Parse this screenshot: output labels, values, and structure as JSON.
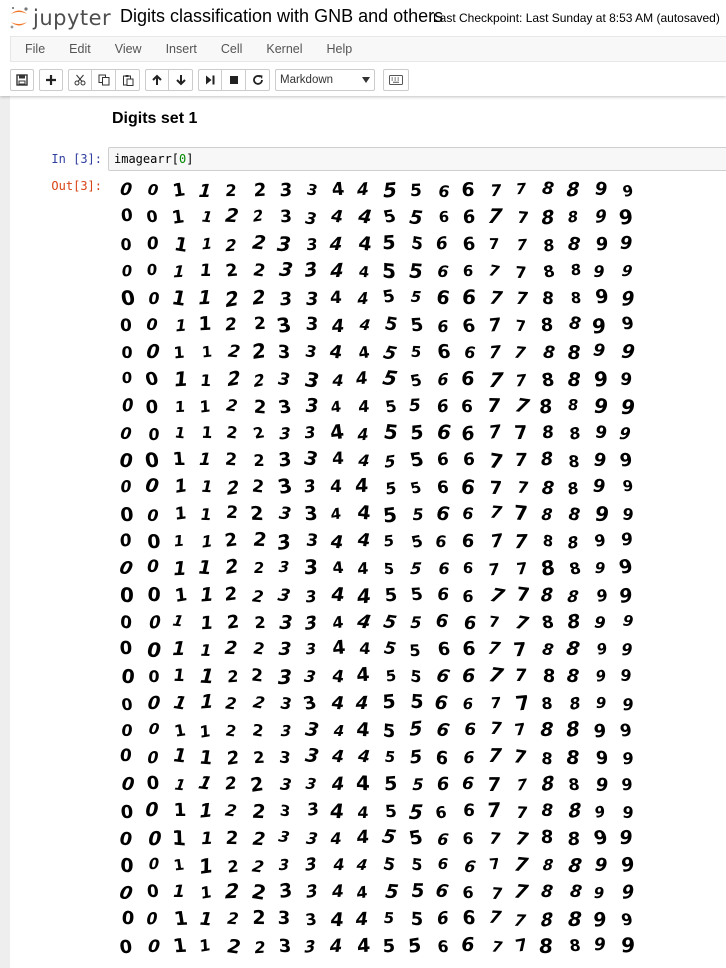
{
  "header": {
    "logo_text": "jupyter",
    "notebook_title": "Digits classification with GNB and others",
    "checkpoint": "Last Checkpoint: Last Sunday at 8:53 AM (autosaved)"
  },
  "menu": [
    "File",
    "Edit",
    "View",
    "Insert",
    "Cell",
    "Kernel",
    "Help"
  ],
  "toolbar": {
    "cell_type": "Markdown",
    "icons": [
      "save-icon",
      "plus-icon",
      "cut-icon",
      "copy-icon",
      "paste-icon",
      "arrow-up-icon",
      "arrow-down-icon",
      "step-forward-icon",
      "stop-icon",
      "restart-icon",
      "keyboard-icon"
    ]
  },
  "cells": {
    "markdown_heading": "Digits set 1",
    "input_prompt": "In [3]:",
    "code_prefix": "imagearr[",
    "code_index": "0",
    "code_suffix": "]",
    "output_prompt": "Out[3]:"
  },
  "output_image": {
    "rows": 29,
    "digits_per_row": [
      "0",
      "0",
      "1",
      "1",
      "2",
      "2",
      "3",
      "3",
      "4",
      "4",
      "5",
      "5",
      "6",
      "6",
      "7",
      "7",
      "8",
      "8",
      "9",
      "9"
    ]
  }
}
